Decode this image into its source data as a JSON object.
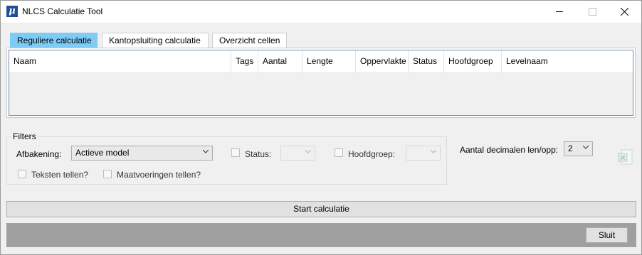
{
  "window": {
    "title": "NLCS Calculatie Tool",
    "app_icon_glyph": "μ",
    "icons": [
      "app-logo-icon",
      "minimize-icon",
      "maximize-icon",
      "close-icon"
    ]
  },
  "tabs": [
    {
      "label": "Reguliere calculatie",
      "selected": true
    },
    {
      "label": "Kantopsluiting calculatie",
      "selected": false
    },
    {
      "label": "Overzicht cellen",
      "selected": false
    }
  ],
  "grid": {
    "columns": [
      "Naam",
      "Tags",
      "Aantal",
      "Lengte",
      "Oppervlakte",
      "Status",
      "Hoofdgroep",
      "Levelnaam"
    ],
    "rows": []
  },
  "filters": {
    "legend": "Filters",
    "afbakening": {
      "label": "Afbakening:",
      "value": "Actieve model"
    },
    "status": {
      "label": "Status:",
      "value": "",
      "checked": false
    },
    "hoofdgroep": {
      "label": "Hoofdgroep:",
      "value": "",
      "checked": false
    },
    "teksten": {
      "label": "Teksten tellen?",
      "checked": false
    },
    "maatvoeringen": {
      "label": "Maatvoeringen tellen?",
      "checked": false
    }
  },
  "decimals": {
    "label": "Aantal decimalen len/opp:",
    "value": "2"
  },
  "export": {
    "icon": "excel-export-icon"
  },
  "actions": {
    "start_label": "Start calculatie",
    "close_label": "Sluit"
  },
  "colors": {
    "active_tab": "#7ecbf5",
    "grid_border": "#6f8db5",
    "footer": "#a0a0a0"
  }
}
